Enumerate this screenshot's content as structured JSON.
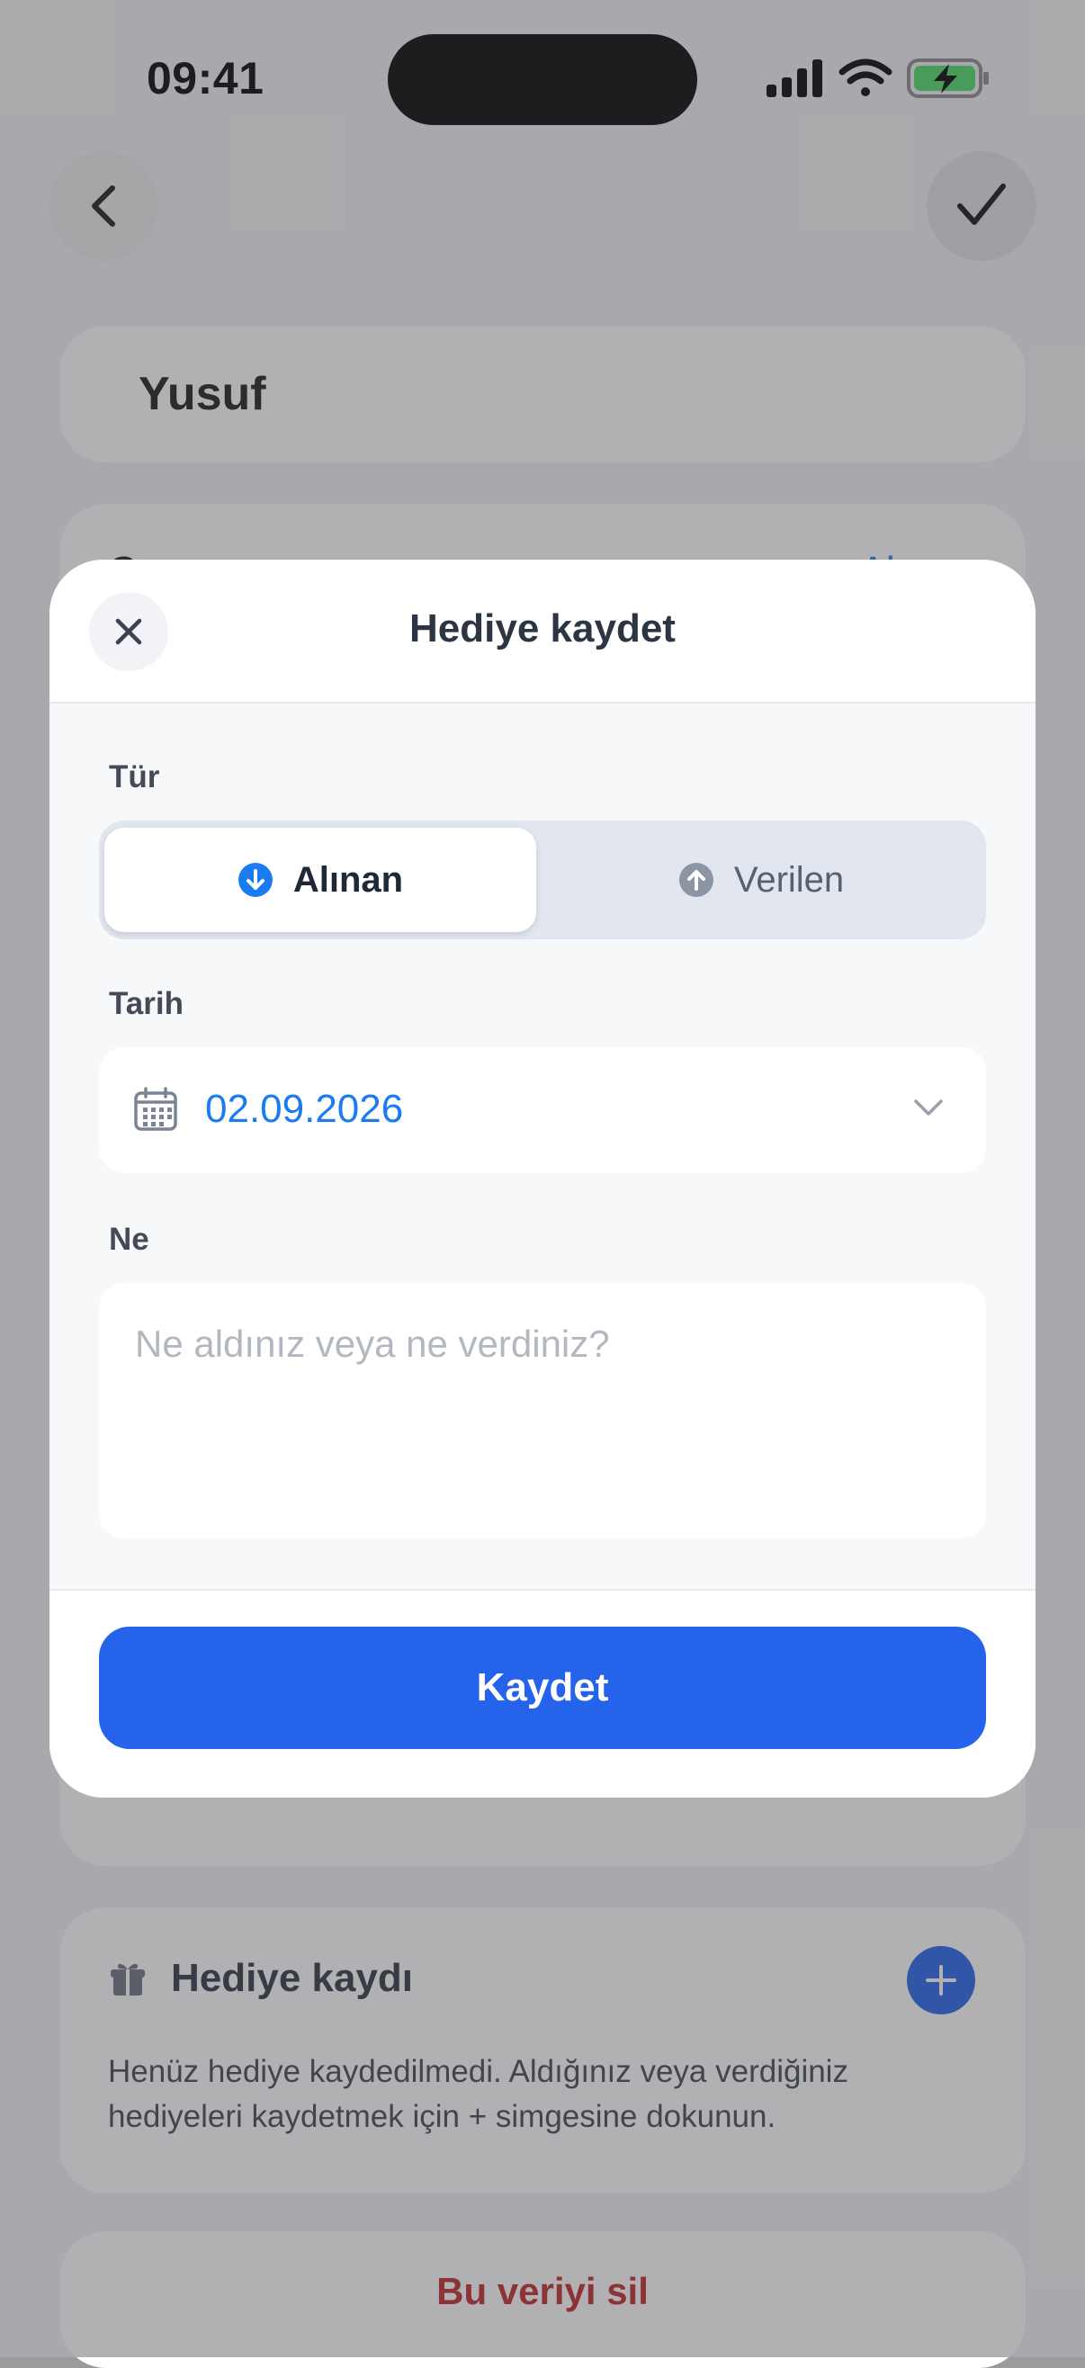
{
  "status_bar": {
    "time": "09:41"
  },
  "background": {
    "name_value": "Yusuf",
    "partial_row_left": "G",
    "partial_row_right": "+ Al",
    "gift_section": {
      "title": "Hediye kaydı",
      "description": "Henüz hediye kaydedilmedi. Aldığınız veya verdiğiniz hediyeleri kaydetmek için + simgesine dokunun."
    },
    "delete_label": "Bu veriyi sil"
  },
  "modal": {
    "title": "Hediye kaydet",
    "type_label": "Tür",
    "type_options": [
      {
        "label": "Alınan",
        "selected": true
      },
      {
        "label": "Verilen",
        "selected": false
      }
    ],
    "date_label": "Tarih",
    "date_value": "02.09.2026",
    "what_label": "Ne",
    "what_placeholder": "Ne aldınız veya ne verdiniz?",
    "save_label": "Kaydet"
  },
  "colors": {
    "accent": "#2563eb",
    "link_blue": "#1a7cf0",
    "danger": "#c02626"
  }
}
